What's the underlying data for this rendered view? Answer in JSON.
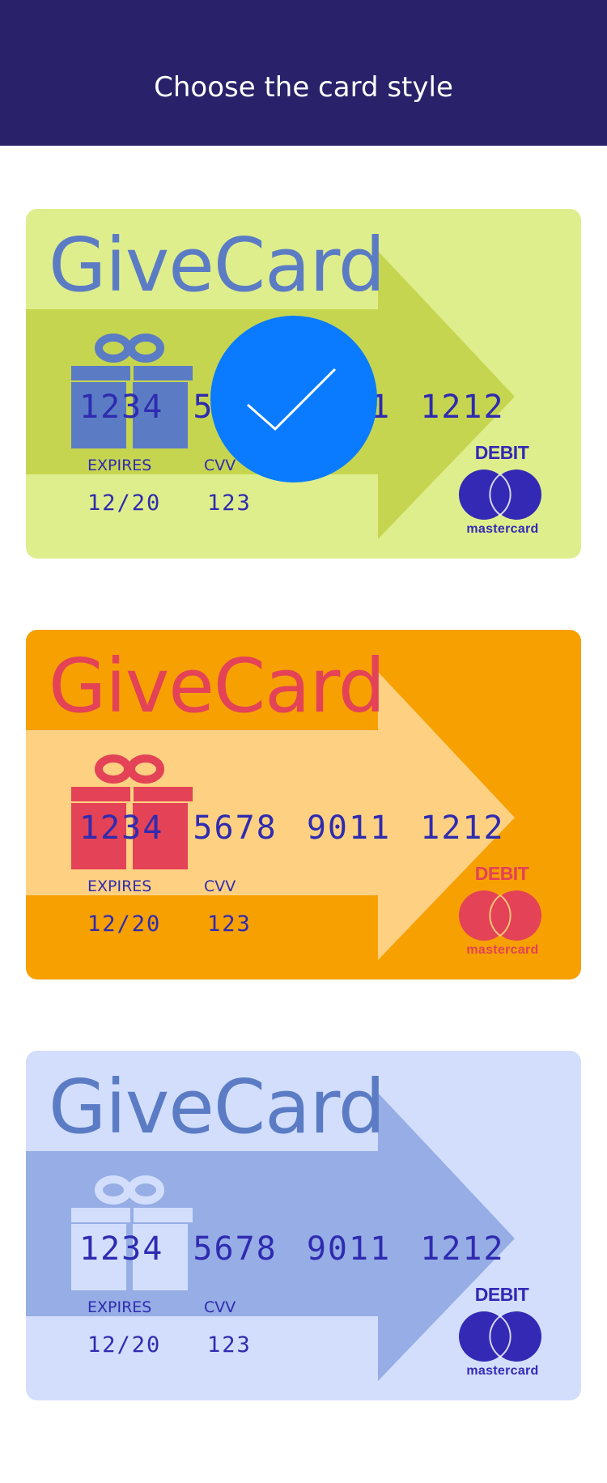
{
  "header": {
    "title": "Choose the card style"
  },
  "cards": [
    {
      "id": "green",
      "brand": "GiveCard",
      "number": "1234 5678 9011 1212",
      "expires_label": "EXPIRES",
      "expires_value": "12/20",
      "cvv_label": "CVV",
      "cvv_value": "123",
      "debit_label": "DEBIT",
      "network_label": "mastercard",
      "selected": true,
      "colors": {
        "background": "#dfee8c",
        "arrow": "#c6d550",
        "brand_text": "#5b7cc4",
        "gift": "#5b7cc4",
        "mastercard": "#3329b5"
      }
    },
    {
      "id": "orange",
      "brand": "GiveCard",
      "number": "1234 5678 9011 1212",
      "expires_label": "EXPIRES",
      "expires_value": "12/20",
      "cvv_label": "CVV",
      "cvv_value": "123",
      "debit_label": "DEBIT",
      "network_label": "mastercard",
      "selected": false,
      "colors": {
        "background": "#f7a002",
        "arrow": "#fed182",
        "brand_text": "#e34257",
        "gift": "#e34257",
        "mastercard": "#e34257"
      }
    },
    {
      "id": "blue",
      "brand": "GiveCard",
      "number": "1234 5678 9011 1212",
      "expires_label": "EXPIRES",
      "expires_value": "12/20",
      "cvv_label": "CVV",
      "cvv_value": "123",
      "debit_label": "DEBIT",
      "network_label": "mastercard",
      "selected": false,
      "colors": {
        "background": "#d2defc",
        "arrow": "#96ade5",
        "brand_text": "#5b7cc4",
        "gift": "#d2defc",
        "mastercard": "#3329b5"
      }
    }
  ],
  "selection_indicator": {
    "icon": "checkmark-icon",
    "color": "#0a7bff"
  },
  "header_color": "#29226a",
  "number_text_color": "#2f2bb0"
}
